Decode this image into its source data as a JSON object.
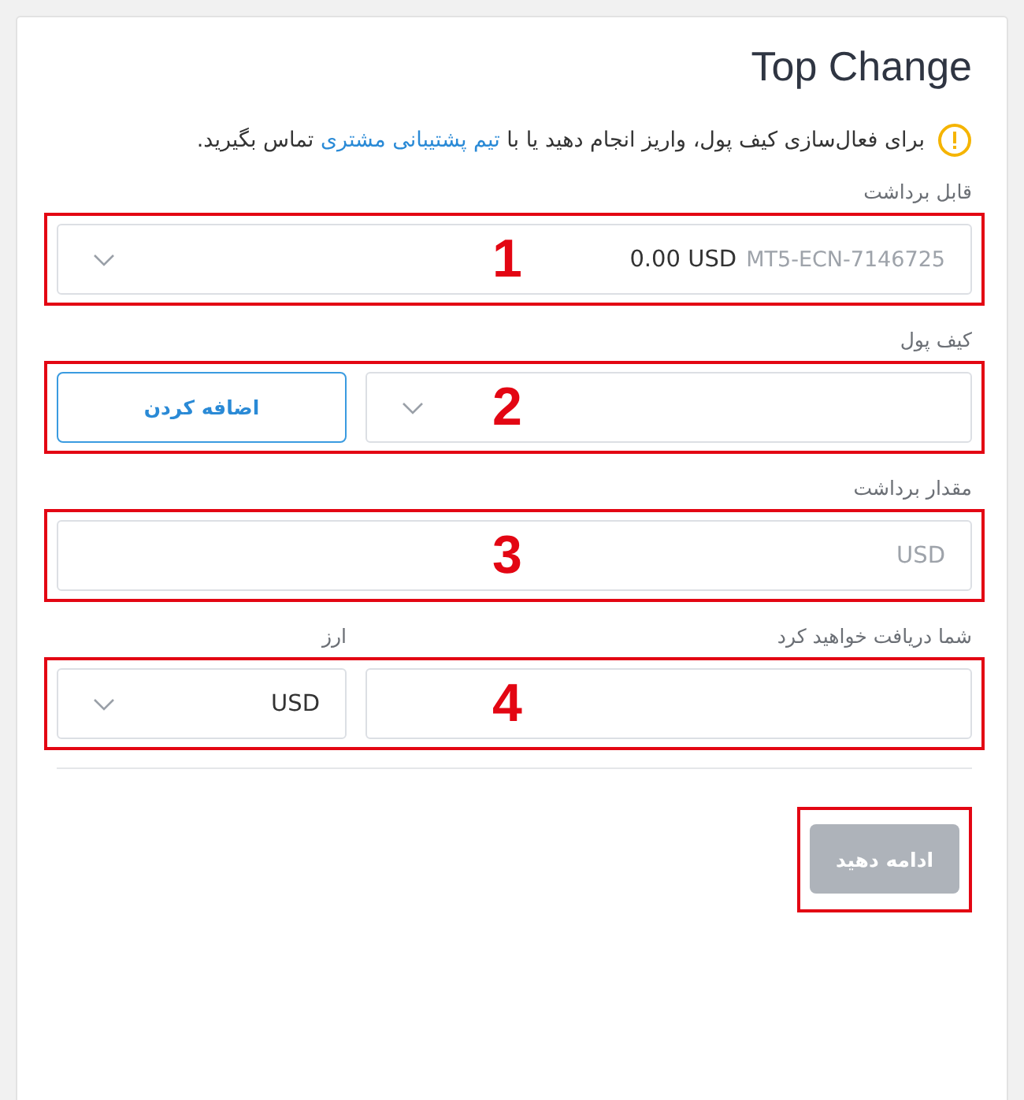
{
  "title": "Top Change",
  "notice": {
    "before": "برای فعال‌سازی کیف پول، واریز انجام دهید یا با ",
    "link": "تیم پشتیبانی مشتری",
    "after": " تماس بگیرید."
  },
  "sections": [
    {
      "annotation": "1",
      "controls": [
        {
          "kind": "select",
          "label": "قابل برداشت",
          "value": "0.00 USD",
          "detail": "MT5-ECN-7146725"
        }
      ]
    },
    {
      "annotation": "2",
      "controls": [
        {
          "kind": "select",
          "label": "کیف پول"
        },
        {
          "kind": "button",
          "text": "اضافه کردن"
        }
      ]
    },
    {
      "annotation": "3",
      "controls": [
        {
          "kind": "input",
          "label": "مقدار برداشت",
          "placeholder": "USD"
        }
      ]
    },
    {
      "annotation": "4",
      "controls": [
        {
          "kind": "input",
          "label": "شما دریافت خواهید کرد"
        },
        {
          "kind": "select",
          "label": "ارز",
          "value": "USD"
        }
      ]
    }
  ],
  "continue_button": {
    "text": "ادامه دهید",
    "disabled": true
  }
}
